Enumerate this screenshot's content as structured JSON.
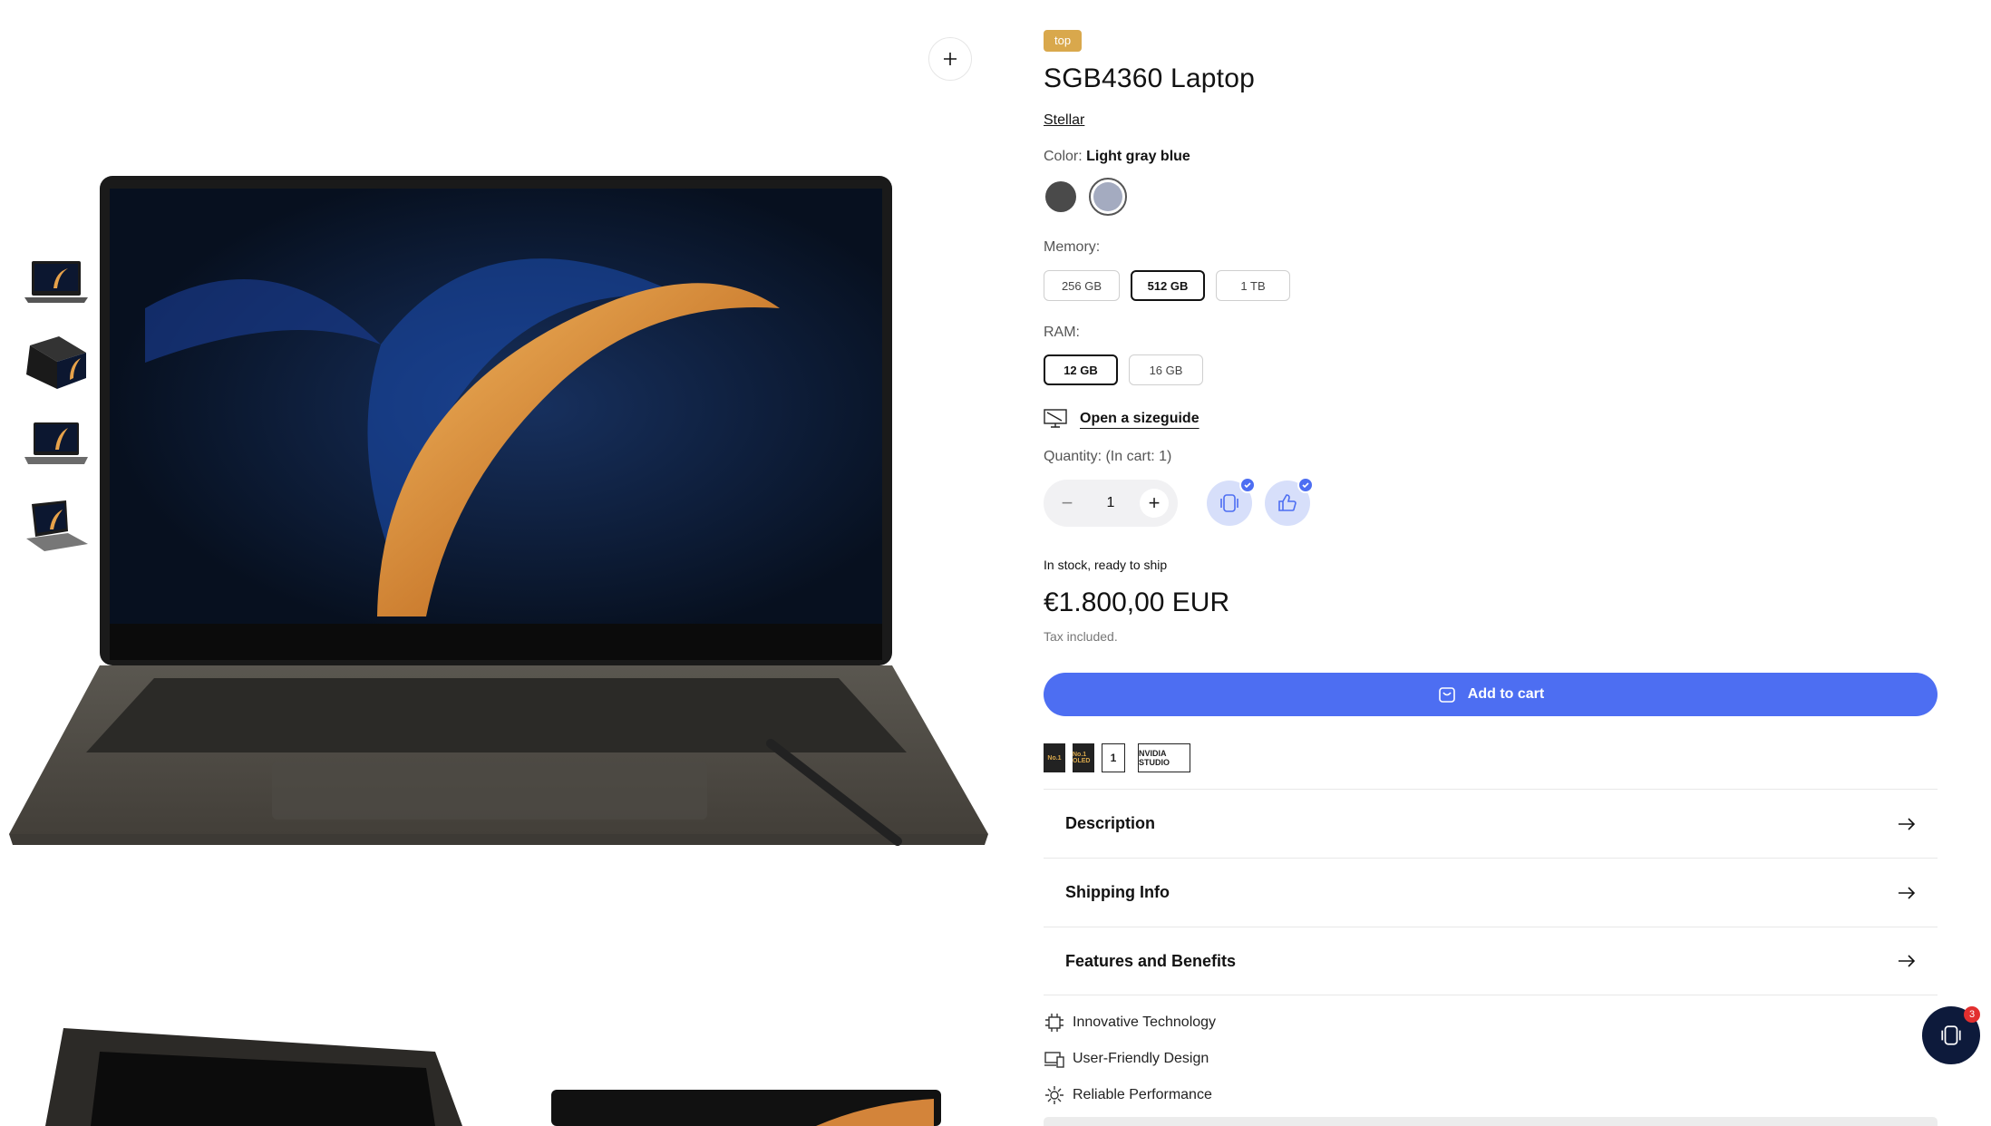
{
  "product": {
    "badge": "top",
    "title": "SGB4360 Laptop",
    "vendor": "Stellar",
    "color": {
      "label": "Color:",
      "selected": "Light gray blue",
      "swatches": [
        {
          "name": "Graphite",
          "hex": "#4a4a4a"
        },
        {
          "name": "Light gray blue",
          "hex": "#a4abc0"
        }
      ]
    },
    "memory": {
      "label": "Memory:",
      "options": [
        "256 GB",
        "512 GB",
        "1 TB"
      ],
      "selected": "512 GB"
    },
    "ram": {
      "label": "RAM:",
      "options": [
        "12 GB",
        "16 GB"
      ],
      "selected": "12 GB"
    },
    "sizeguide_label": "Open a sizeguide",
    "quantity": {
      "label": "Quantity: (In cart: 1)",
      "value": "1",
      "minus": "−",
      "plus": "+"
    },
    "stock": "In stock, ready to ship",
    "price": "€1.800,00 EUR",
    "tax": "Tax included.",
    "add_to_cart": "Add to cart",
    "badges": [
      "No.1",
      "No.1 OLED",
      "1",
      "NVIDIA STUDIO"
    ],
    "accordions": [
      "Description",
      "Shipping Info",
      "Features and Benefits"
    ],
    "features": [
      "Innovative Technology",
      "User-Friendly Design",
      "Reliable Performance"
    ]
  },
  "chat": {
    "badge_count": "3"
  },
  "colors": {
    "accent": "#4d6ef2",
    "badge": "#d9a84c",
    "chat_bg": "#0d1a3b"
  }
}
